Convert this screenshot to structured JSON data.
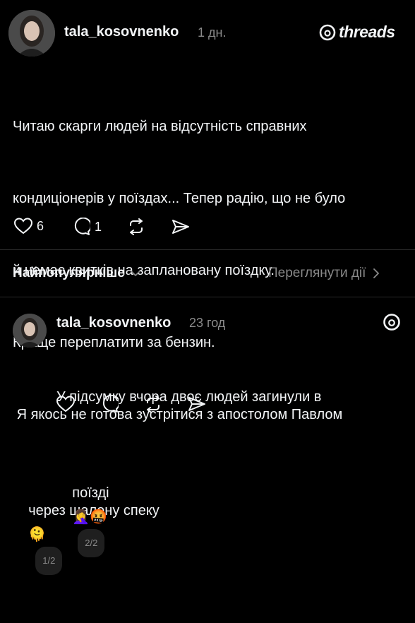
{
  "post1": {
    "username": "tala_kosovnenko",
    "time": "1 дн.",
    "brand": "threads",
    "lines": [
      "Читаю скарги людей на відсутність справних",
      "кондиціонерів у поїздах... Тепер радію, що не було",
      "й немає квитків на заплановану поїздку.",
      "Краще переплатити за бензин.",
      " Я якось не готова зустрітися з апостолом Павлом",
      "через шалену спеку"
    ],
    "emoji": "🫠",
    "page_indicator": "1/2",
    "likes": "6",
    "replies": "1"
  },
  "sort": {
    "label": "Найпопулярніше",
    "view_activity": "Переглянути дії"
  },
  "post2": {
    "username": "tala_kosovnenko",
    "time": "23 год",
    "lines": [
      "У підсумку вчора двоє людей загинули в",
      "поїзді"
    ],
    "emoji": "🤦‍♀️🤬",
    "page_indicator": "2/2"
  }
}
